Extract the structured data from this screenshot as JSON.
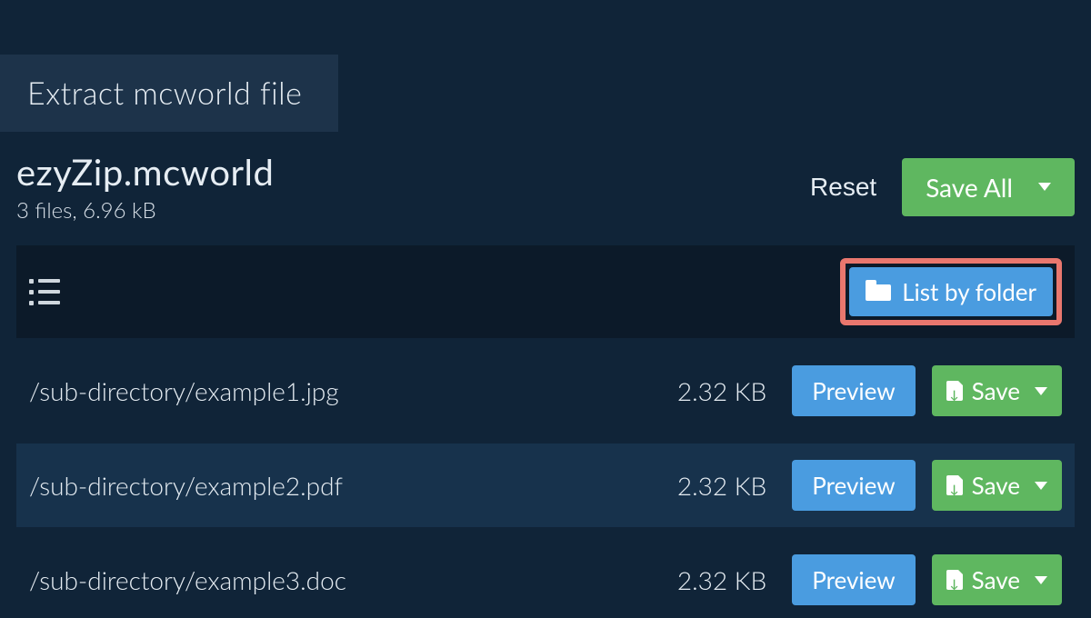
{
  "tab": {
    "label": "Extract mcworld file"
  },
  "header": {
    "filename": "ezyZip.mcworld",
    "subtitle": "3 files, 6.96 kB",
    "reset_label": "Reset",
    "save_all_label": "Save All"
  },
  "toolbar": {
    "list_by_folder_label": "List by folder"
  },
  "rows": [
    {
      "path": "/sub-directory/example1.jpg",
      "size": "2.32 KB",
      "preview": "Preview",
      "save": "Save"
    },
    {
      "path": "/sub-directory/example2.pdf",
      "size": "2.32 KB",
      "preview": "Preview",
      "save": "Save"
    },
    {
      "path": "/sub-directory/example3.doc",
      "size": "2.32 KB",
      "preview": "Preview",
      "save": "Save"
    }
  ]
}
